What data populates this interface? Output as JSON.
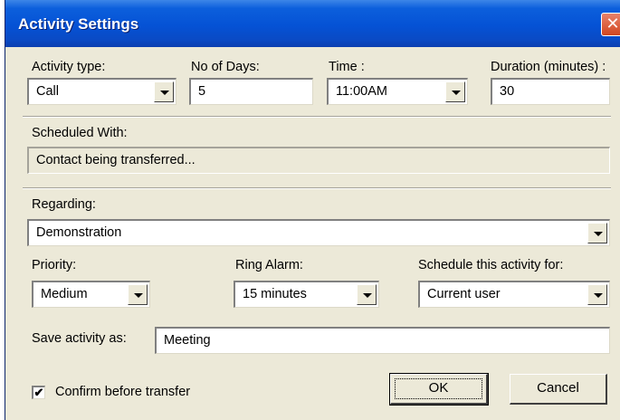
{
  "window": {
    "title": "Activity Settings",
    "close_glyph": "✕"
  },
  "labels": {
    "activity_type": "Activity type:",
    "no_of_days": "No of Days:",
    "time": "Time :",
    "duration": "Duration (minutes) :",
    "scheduled_with": "Scheduled With:",
    "regarding": "Regarding:",
    "priority": "Priority:",
    "ring_alarm": "Ring Alarm:",
    "schedule_for": "Schedule this activity for:",
    "save_as": "Save activity as:"
  },
  "fields": {
    "activity_type": "Call",
    "no_of_days": "5",
    "time": "11:00AM",
    "duration": "30",
    "scheduled_with": "Contact being transferred...",
    "regarding": "Demonstration",
    "priority": "Medium",
    "ring_alarm": "15 minutes",
    "schedule_for": "Current user",
    "save_as": "Meeting"
  },
  "checkbox": {
    "label": "Confirm before transfer",
    "checked": true,
    "mark": "✔"
  },
  "buttons": {
    "ok": "OK",
    "cancel": "Cancel"
  }
}
